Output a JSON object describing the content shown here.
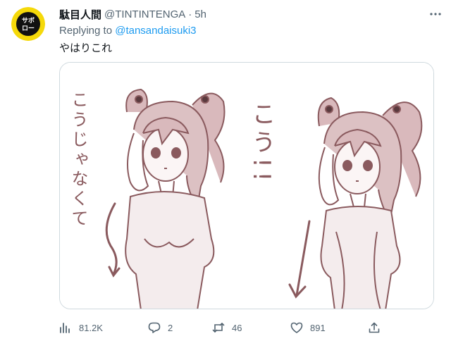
{
  "tweet": {
    "display_name": "駄目人間",
    "handle": "@TINTINTENGA",
    "separator": "·",
    "time": "5h",
    "reply_prefix": "Replying to",
    "reply_handle": "@tansandaisuki3",
    "text": "やはりこれ",
    "avatar_text": "サボロー",
    "media_left_caption": "こうじゃなくて",
    "media_right_caption": "こう!!"
  },
  "actions": {
    "views": "81.2K",
    "replies": "2",
    "retweets": "46",
    "likes": "891"
  },
  "colors": {
    "accent": "#1d9bf0",
    "muted": "#536471",
    "sketch": "#8a5a5e",
    "avatar_bg": "#f5d90a"
  },
  "icons": [
    "more-icon",
    "views-icon",
    "reply-icon",
    "retweet-icon",
    "like-icon",
    "share-icon"
  ]
}
